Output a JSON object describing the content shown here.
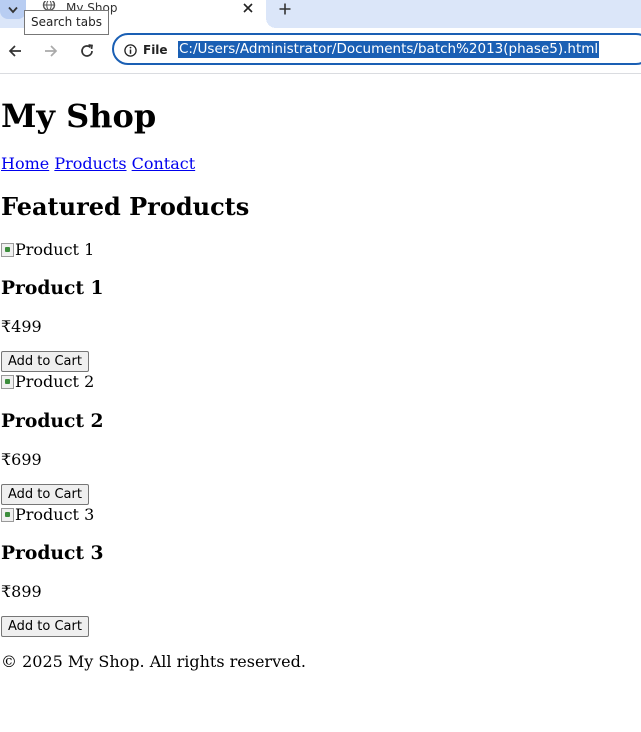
{
  "browser": {
    "tab_title": "My Shop",
    "tooltip": "Search tabs",
    "site_info_label": "File",
    "url": "C:/Users/Administrator/Documents/batch%2013(phase5).html"
  },
  "page": {
    "heading": "My Shop",
    "nav": [
      "Home",
      "Products",
      "Contact"
    ],
    "section_title": "Featured Products",
    "products": [
      {
        "image_alt": "Product 1",
        "name": "Product 1",
        "price": "₹499",
        "button": "Add to Cart"
      },
      {
        "image_alt": "Product 2",
        "name": "Product 2",
        "price": "₹699",
        "button": "Add to Cart"
      },
      {
        "image_alt": "Product 3",
        "name": "Product 3",
        "price": "₹899",
        "button": "Add to Cart"
      }
    ],
    "footer": "© 2025 My Shop. All rights reserved."
  }
}
